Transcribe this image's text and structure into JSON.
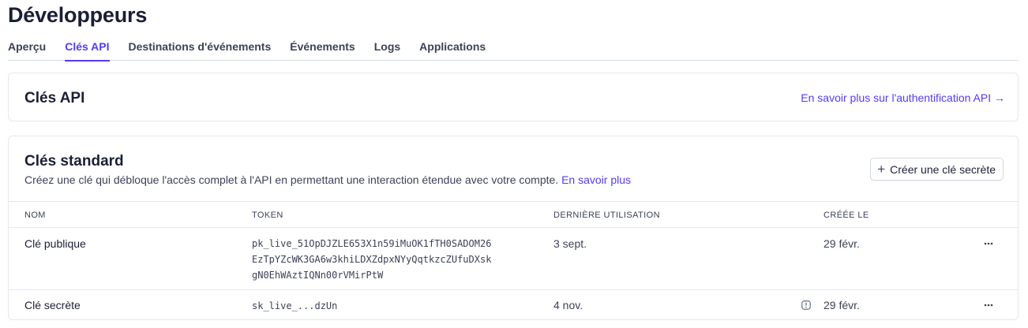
{
  "page": {
    "title": "Développeurs"
  },
  "tabs": [
    {
      "label": "Aperçu",
      "active": false
    },
    {
      "label": "Clés API",
      "active": true
    },
    {
      "label": "Destinations d'événements",
      "active": false
    },
    {
      "label": "Événements",
      "active": false
    },
    {
      "label": "Logs",
      "active": false
    },
    {
      "label": "Applications",
      "active": false
    }
  ],
  "api_card": {
    "title": "Clés API",
    "learn_more": "En savoir plus sur l'authentification API →"
  },
  "standard_keys": {
    "title": "Clés standard",
    "description": "Créez une clé qui débloque l'accès complet à l'API en permettant une interaction étendue avec votre compte.",
    "description_link": "En savoir plus",
    "create_button": "Créer une clé secrète",
    "columns": {
      "name": "NOM",
      "token": "TOKEN",
      "last_used": "DERNIÈRE UTILISATION",
      "created": "CRÉÉE LE"
    },
    "rows": [
      {
        "name": "Clé publique",
        "token_lines": [
          "pk_live_51OpDJZLE653X1n59iMuOK1fTH0SADOM26",
          "EzTpYZcWK3GA6w3khiLDXZdpxNYyQqtkzcZUfuDXsk",
          "gN0EhWAztIQNn00rVMirPtW"
        ],
        "last_used": "3 sept.",
        "created": "29 févr."
      },
      {
        "name": "Clé secrète",
        "token": "sk_live_...dzUn",
        "last_used": "4 nov.",
        "created": "29 févr."
      }
    ]
  },
  "icons": {
    "plus": "plus-icon",
    "more": "more-horizontal-icon",
    "info": "info-icon"
  },
  "colors": {
    "accent": "#533afd",
    "text": "#1a1f36",
    "muted": "#3c4257",
    "border": "#e3e8ee"
  }
}
